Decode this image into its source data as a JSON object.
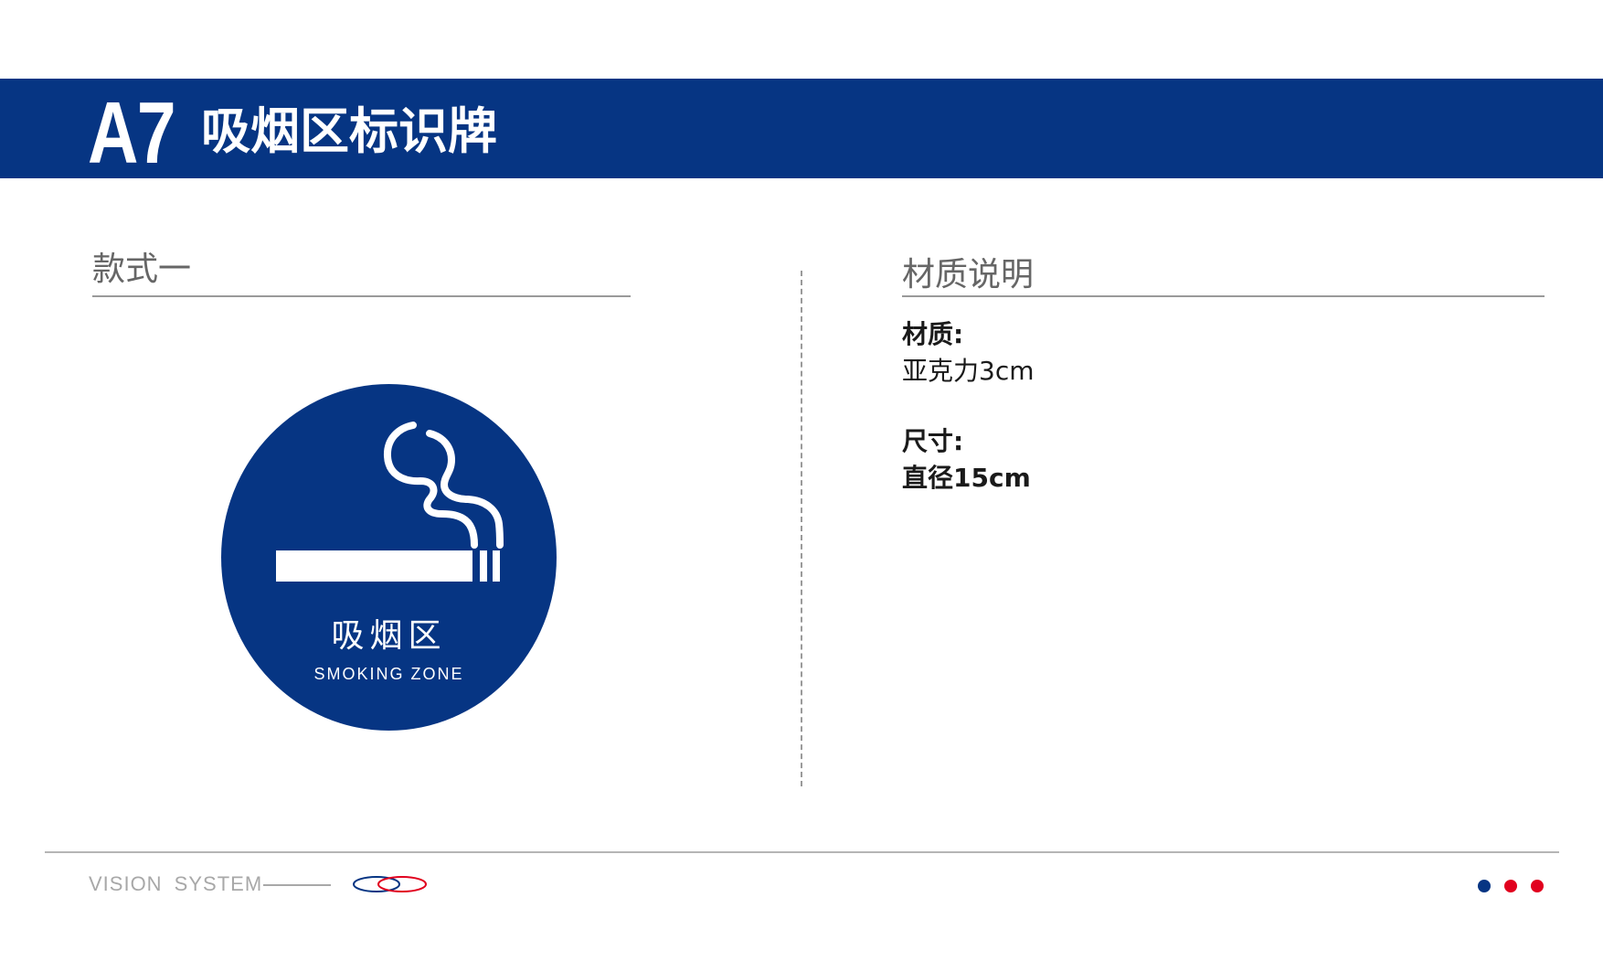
{
  "header": {
    "code": "A7",
    "title": "吸烟区标识牌"
  },
  "left_section": {
    "title": "款式一"
  },
  "sign": {
    "text_cn": "吸烟区",
    "text_en": "SMOKING ZONE",
    "icon": "cigarette-icon"
  },
  "right_section": {
    "title": "材质说明",
    "material_label": "材质:",
    "material_value": "亚克力3cm",
    "size_label": "尺寸:",
    "size_value": "直径15cm"
  },
  "footer": {
    "text": "VISION SYSTEM",
    "logo": "interlocking-rings-logo",
    "dots_icon": "three-dots-icon"
  },
  "colors": {
    "brand_blue": "#063583",
    "accent_red": "#e1001e",
    "white": "#ffffff",
    "gray_text": "#666666",
    "footer_gray": "#a8a8a8"
  }
}
